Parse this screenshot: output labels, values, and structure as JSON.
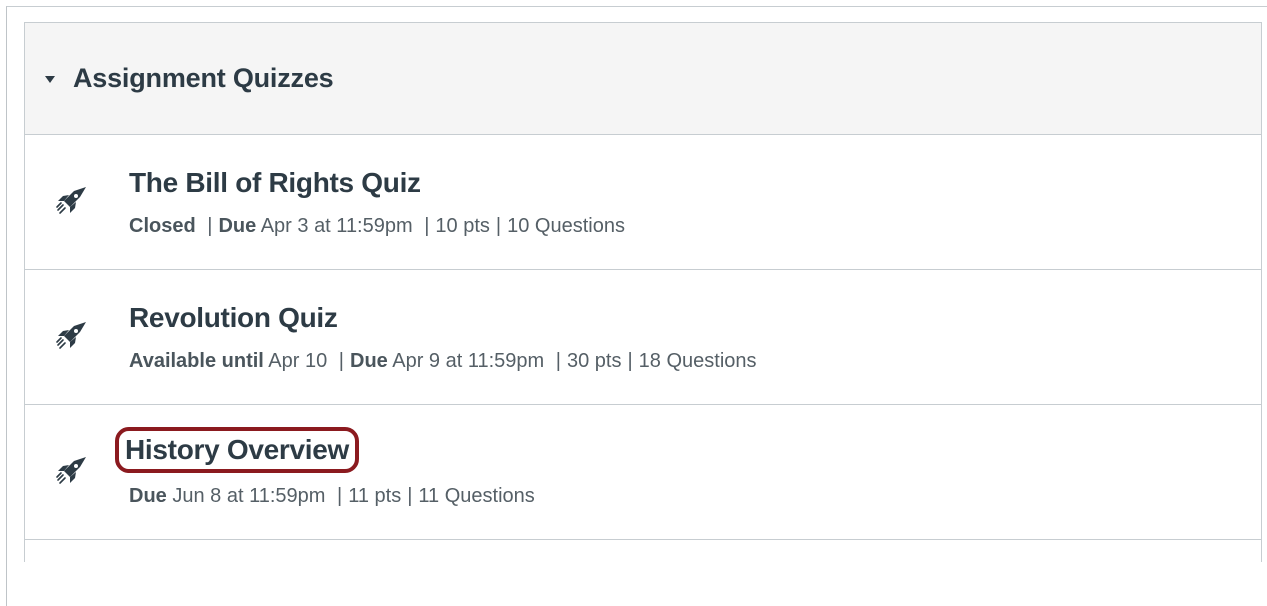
{
  "group": {
    "title": "Assignment Quizzes"
  },
  "quizzes": [
    {
      "title": "The Bill of Rights Quiz",
      "status_label": "Closed",
      "due_label": "Due",
      "due_value": "Apr 3 at 11:59pm",
      "points": "10 pts",
      "questions": "10 Questions"
    },
    {
      "title": "Revolution Quiz",
      "status_label": "Available until",
      "status_value": "Apr 10",
      "due_label": "Due",
      "due_value": "Apr 9 at 11:59pm",
      "points": "30 pts",
      "questions": "18 Questions"
    },
    {
      "title": "History Overview",
      "due_label": "Due",
      "due_value": "Jun 8 at 11:59pm",
      "points": "11 pts",
      "questions": "11 Questions"
    }
  ],
  "separator": "|",
  "colors": {
    "text": "#2d3b45",
    "meta": "#555f66",
    "border": "#c7cdd1",
    "header_bg": "#f5f5f5",
    "highlight": "#8b1a1f"
  },
  "icons": {
    "caret": "caret-down-icon",
    "quiz": "rocket-quiz-icon"
  }
}
